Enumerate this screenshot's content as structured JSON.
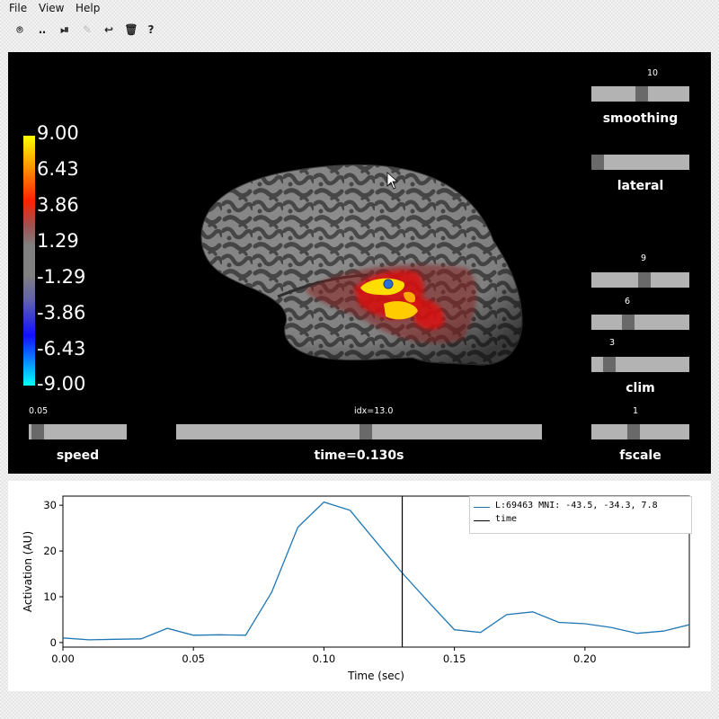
{
  "menu": [
    "File",
    "View",
    "Help"
  ],
  "toolbar": {
    "icons": [
      "screenshot-icon",
      "movie-icon",
      "play-pause-icon",
      "pencil-icon",
      "undo-icon",
      "trash-icon",
      "help-icon"
    ],
    "glyphs": [
      "⌾",
      "‥",
      "⏯",
      "✎",
      "↩",
      "🗑",
      "?"
    ]
  },
  "colorbar": {
    "ticks": [
      "9.00",
      "6.43",
      "3.86",
      "1.29",
      "-1.29",
      "-3.86",
      "-6.43",
      "-9.00"
    ]
  },
  "sliders": {
    "smoothing": {
      "value": "10",
      "label": "smoothing",
      "fraction": 0.52
    },
    "lateral": {
      "value": "",
      "label": "lateral",
      "fraction": 0.0
    },
    "clim_high": {
      "value": "9",
      "fraction": 0.55
    },
    "clim_mid": {
      "value": "6",
      "fraction": 0.36
    },
    "clim_low": {
      "value": "3",
      "fraction": 0.14,
      "label": "clim"
    },
    "fscale": {
      "value": "1",
      "label": "fscale",
      "fraction": 0.42
    },
    "speed": {
      "value": "0.05",
      "label": "speed",
      "fraction": 0.03
    },
    "time": {
      "value": "idx=13.0",
      "label": "time=0.130s",
      "fraction": 0.52
    }
  },
  "colors": {
    "trace": "#1f77b4",
    "time_line": "#000000",
    "viewer_bg": "#000000"
  },
  "chart_data": {
    "type": "line",
    "xlabel": "Time (sec)",
    "ylabel": "Activation (AU)",
    "xlim": [
      0.0,
      0.24
    ],
    "ylim": [
      -1,
      32
    ],
    "xticks": [
      "0.00",
      "0.05",
      "0.10",
      "0.15",
      "0.20"
    ],
    "xtick_values": [
      0.0,
      0.05,
      0.1,
      0.15,
      0.2
    ],
    "yticks": [
      "0",
      "10",
      "20",
      "30"
    ],
    "ytick_values": [
      0,
      10,
      20,
      30
    ],
    "series": [
      {
        "name": "L:69463  MNI: -43.5, -34.3,   7.8",
        "x": [
          0.0,
          0.01,
          0.02,
          0.03,
          0.04,
          0.05,
          0.06,
          0.07,
          0.08,
          0.09,
          0.1,
          0.11,
          0.12,
          0.13,
          0.14,
          0.15,
          0.16,
          0.17,
          0.18,
          0.19,
          0.2,
          0.21,
          0.22,
          0.23,
          0.24
        ],
        "y": [
          1.0,
          0.6,
          0.7,
          0.8,
          3.1,
          1.6,
          1.7,
          1.6,
          11.0,
          25.2,
          30.7,
          28.9,
          22.0,
          15.2,
          8.9,
          2.8,
          2.2,
          6.1,
          6.7,
          4.4,
          4.1,
          3.3,
          2.0,
          2.5,
          3.9
        ]
      }
    ],
    "vline": {
      "name": "time",
      "x": 0.13
    },
    "legend": "upper right"
  }
}
